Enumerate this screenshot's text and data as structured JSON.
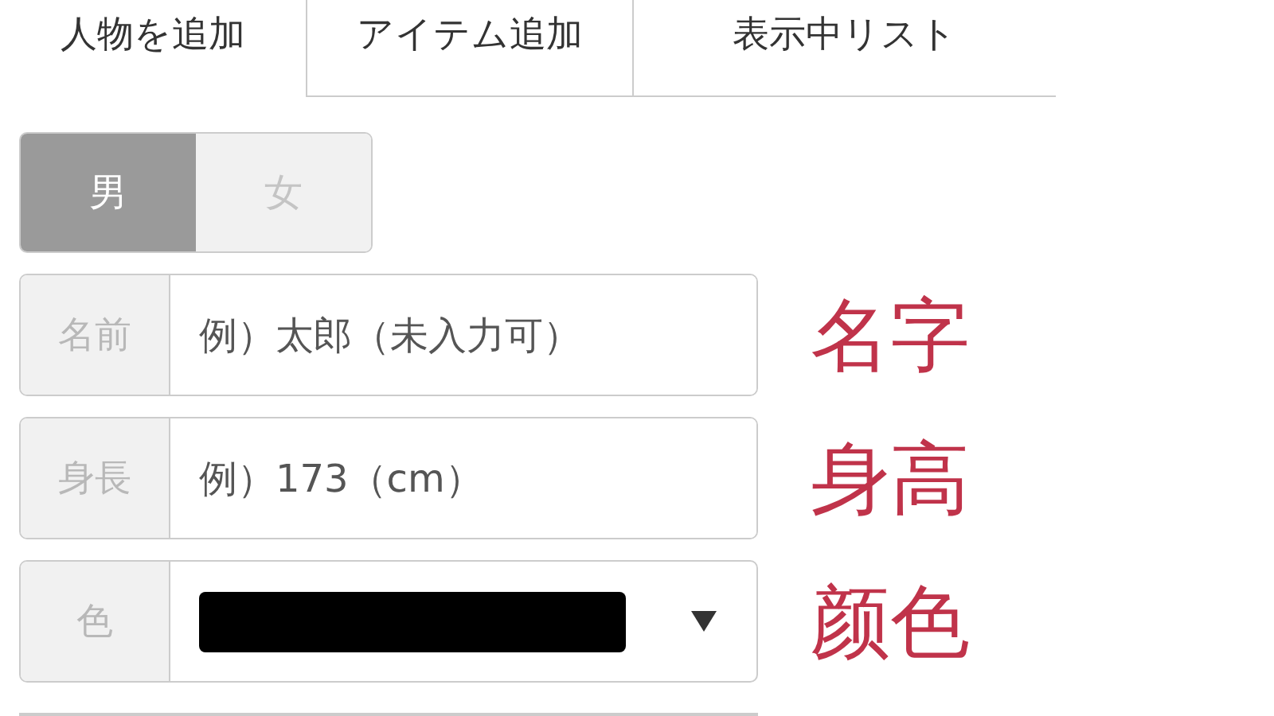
{
  "tabs": [
    {
      "label": "人物を追加",
      "selected": true
    },
    {
      "label": "アイテム追加",
      "selected": false
    },
    {
      "label": "表示中リスト",
      "selected": false
    }
  ],
  "gender": [
    {
      "label": "男",
      "selected": true
    },
    {
      "label": "女",
      "selected": false
    }
  ],
  "fields": [
    {
      "kind": "text",
      "label": "名前",
      "placeholder": "例）太郎（未入力可）",
      "note": "名字"
    },
    {
      "kind": "text",
      "label": "身長",
      "placeholder": "例）173（cm）",
      "note": "身高"
    },
    {
      "kind": "color",
      "label": "色",
      "color": "#000000",
      "note": "颜色"
    }
  ]
}
